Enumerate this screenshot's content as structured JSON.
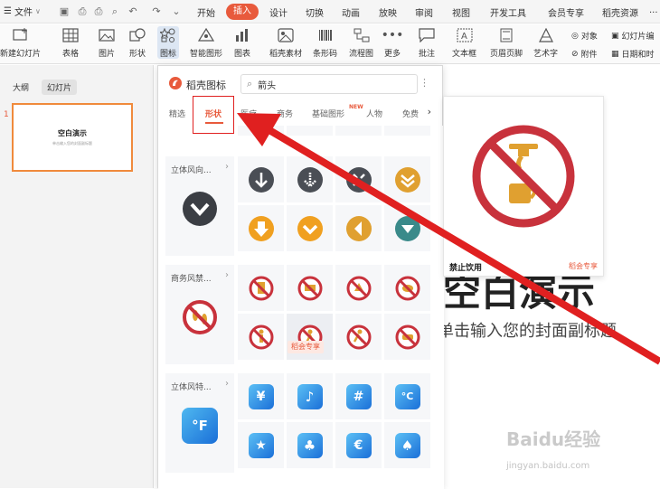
{
  "menubar": {
    "file_label": "文件",
    "tabs": [
      "开始",
      "插入",
      "设计",
      "切换",
      "动画",
      "放映",
      "审阅",
      "视图",
      "开发工具",
      "会员专享",
      "稻壳资源",
      "..."
    ],
    "active_tab": "插入"
  },
  "ribbon": {
    "new_slide": "新建幻灯片",
    "table": "表格",
    "picture": "图片",
    "shape": "形状",
    "icon": "图标",
    "smart_shape": "智能图形",
    "chart": "图表",
    "daoke_material": "稻壳素材",
    "barcode": "条形码",
    "flowchart": "流程图",
    "more": "更多",
    "comment": "批注",
    "textbox": "文本框",
    "header_footer": "页眉页脚",
    "art_text": "艺术字",
    "object": "对象",
    "attachment": "附件",
    "slide_number": "幻灯片编",
    "date_time": "日期和时"
  },
  "left_panel": {
    "tab_outline": "大纲",
    "tab_slides": "幻灯片",
    "slide_number": "1",
    "thumb_title": "空白演示",
    "thumb_subtitle": "单击输入您的封面副标题"
  },
  "popup": {
    "title": "稻壳图标",
    "search_value": "箭头",
    "more": "⋮",
    "categories": [
      "精选",
      "形状",
      "医疗",
      "商务",
      "基础图形",
      "人物",
      "免费"
    ],
    "active_category": "形状",
    "new_badge": "NEW",
    "groups": [
      {
        "name": "立体风向..."
      },
      {
        "name": "商务风禁..."
      },
      {
        "name": "立体风特..."
      }
    ],
    "vip_tag": "稻会专享",
    "glyphs": {
      "yen": "¥",
      "note": "♪",
      "hash": "#",
      "celsius": "°C",
      "fahrenheit": "°F",
      "star": "★",
      "club": "♣",
      "euro": "€",
      "spade": "♠"
    }
  },
  "preview": {
    "name": "禁止饮用",
    "vip": "稻会专享"
  },
  "slide": {
    "title": "空白演示",
    "subtitle": "单击输入您的封面副标题"
  },
  "watermark": {
    "logo": "Baidu经验",
    "url": "jingyan.baidu.com"
  },
  "colors": {
    "accent": "#e85a3c",
    "arrow": "#e02020",
    "ban_red": "#c8323c"
  }
}
